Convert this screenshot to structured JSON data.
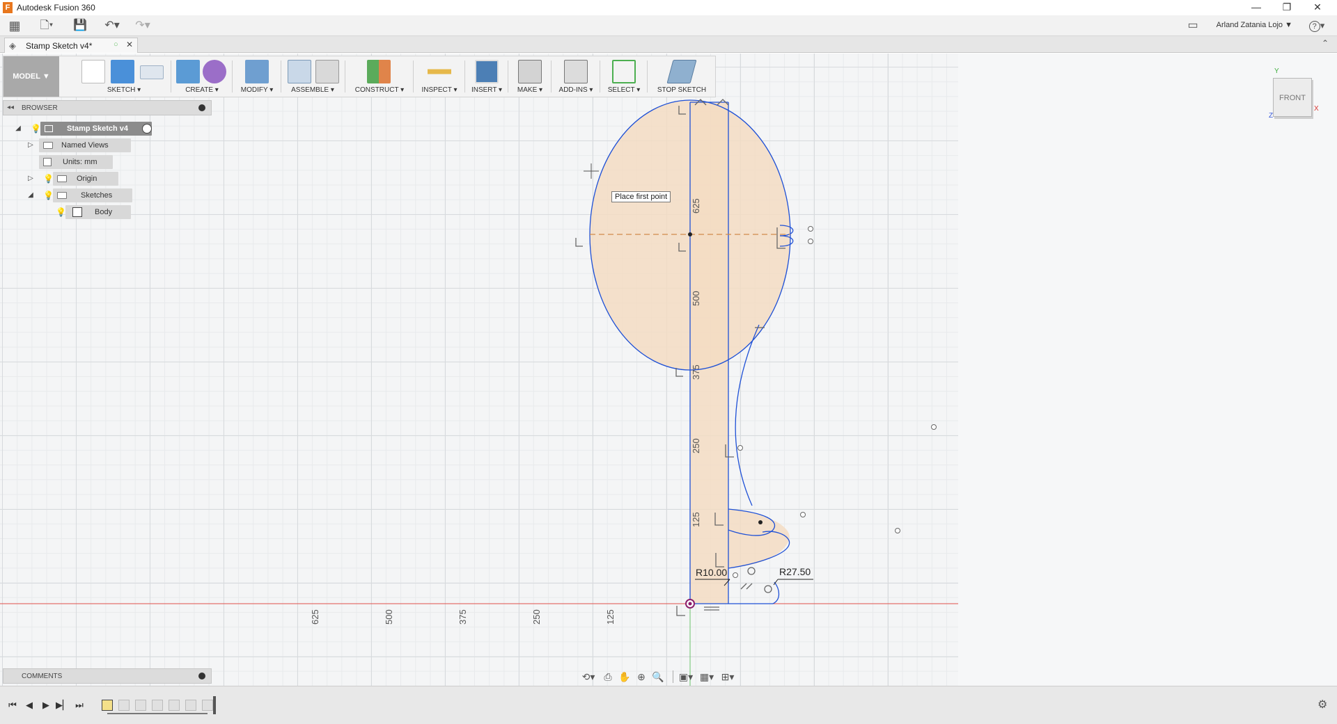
{
  "app": {
    "window_title": "Autodesk Fusion 360",
    "logo_letter": "F",
    "user_name": "Arland Zatania Lojo",
    "user_menu_arrow": "▼",
    "help_icon": "?"
  },
  "document": {
    "tab_title": "Stamp Sketch v4*"
  },
  "toolbar": {
    "workspace": "MODEL ▼",
    "groups": [
      {
        "label": "SKETCH ▾"
      },
      {
        "label": "CREATE ▾"
      },
      {
        "label": "MODIFY ▾"
      },
      {
        "label": "ASSEMBLE ▾"
      },
      {
        "label": "CONSTRUCT ▾"
      },
      {
        "label": "INSPECT ▾"
      },
      {
        "label": "INSERT ▾"
      },
      {
        "label": "MAKE ▾"
      },
      {
        "label": "ADD-INS ▾"
      },
      {
        "label": "SELECT ▾"
      },
      {
        "label": "STOP SKETCH"
      }
    ]
  },
  "browser": {
    "title": "BROWSER",
    "nodes": [
      {
        "label": "Stamp Sketch v4"
      },
      {
        "label": "Named Views"
      },
      {
        "label": "Units: mm"
      },
      {
        "label": "Origin"
      },
      {
        "label": "Sketches"
      },
      {
        "label": "Body"
      }
    ]
  },
  "comments": {
    "title": "COMMENTS"
  },
  "canvas": {
    "tooltip": "Place first point",
    "viewcube_face": "FRONT",
    "axis_y": "Y",
    "axis_x": "X",
    "axis_z": "Z",
    "vertical_ruler": [
      "625",
      "500",
      "375",
      "250",
      "125"
    ],
    "horizontal_ruler": [
      "625",
      "500",
      "375",
      "250",
      "125"
    ],
    "dimensions": {
      "radius_left": "R10.00",
      "radius_right": "R27.50"
    }
  },
  "colors": {
    "sketch_line": "#1e50d6",
    "profile_fill": "#f3dcc3",
    "x_axis": "#e0504a",
    "y_axis": "#6cc36c",
    "construction_line": "#d08a4a",
    "active_tool": "#4a90d9"
  }
}
